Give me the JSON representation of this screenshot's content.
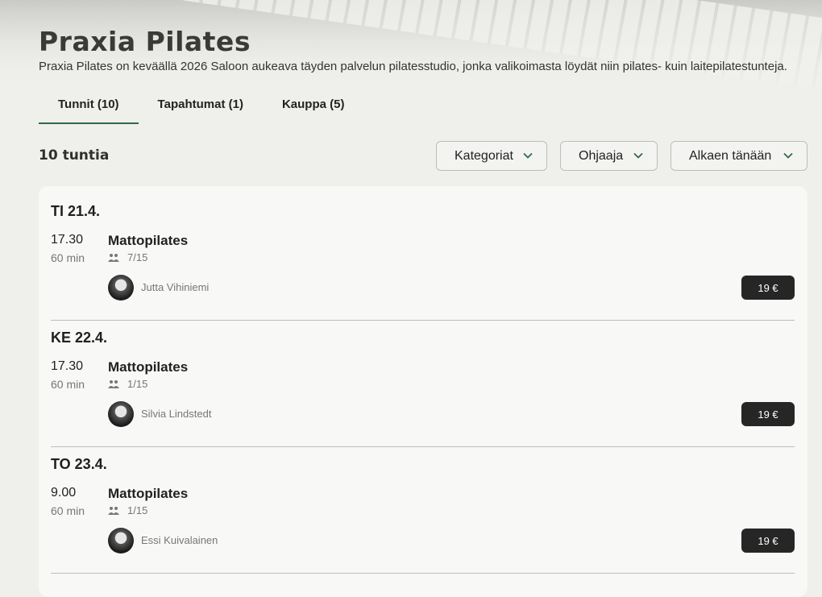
{
  "studio": {
    "name": "Praxia Pilates",
    "description": "Praxia Pilates on keväällä 2026 Saloon aukeava täyden palvelun pilatesstudio, jonka valikoimasta löydät niin pilates- kuin laitepilatestunteja."
  },
  "tabs": [
    {
      "label": "Tunnit (10)",
      "active": true
    },
    {
      "label": "Tapahtumat (1)",
      "active": false
    },
    {
      "label": "Kauppa (5)",
      "active": false
    }
  ],
  "list": {
    "count_label": "10 tuntia"
  },
  "filters": {
    "category": "Kategoriat",
    "instructor": "Ohjaaja",
    "start": "Alkaen tänään"
  },
  "sessions": [
    {
      "day": "TI 21.4.",
      "time": "17.30",
      "duration": "60 min",
      "class": "Mattopilates",
      "capacity": "7/15",
      "instructor": "Jutta Vihiniemi",
      "price": "19 €"
    },
    {
      "day": "KE 22.4.",
      "time": "17.30",
      "duration": "60 min",
      "class": "Mattopilates",
      "capacity": "1/15",
      "instructor": "Silvia Lindstedt",
      "price": "19 €"
    },
    {
      "day": "TO 23.4.",
      "time": "9.00",
      "duration": "60 min",
      "class": "Mattopilates",
      "capacity": "1/15",
      "instructor": "Essi Kuivalainen",
      "price": "19 €"
    }
  ],
  "colors": {
    "accent": "#2e6b44",
    "price_bg": "#262626",
    "card_bg": "#f8f8f6"
  }
}
